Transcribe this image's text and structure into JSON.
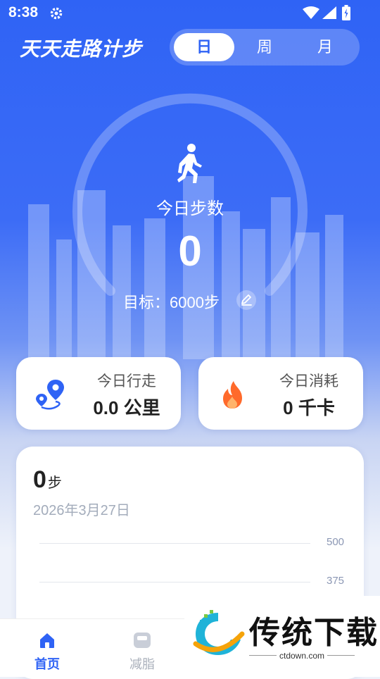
{
  "status_bar": {
    "time": "8:38"
  },
  "header": {
    "app_title": "天天走路计步",
    "period_tabs": [
      {
        "label": "日",
        "active": true
      },
      {
        "label": "周",
        "active": false
      },
      {
        "label": "月",
        "active": false
      }
    ]
  },
  "summary": {
    "today_label": "今日步数",
    "steps": "0",
    "goal_text": "目标：6000步",
    "progress": 0
  },
  "stats": {
    "distance": {
      "label": "今日行走",
      "value": "0.0 公里",
      "icon": "route-pin-icon"
    },
    "calories": {
      "label": "今日消耗",
      "value": "0 千卡",
      "icon": "flame-icon"
    }
  },
  "chart_card": {
    "steps_value": "0",
    "steps_unit": "步",
    "date": "2026年3月27日"
  },
  "chart_data": {
    "type": "bar",
    "y_ticks": [
      "500",
      "375"
    ],
    "ylim": [
      0,
      500
    ],
    "values": []
  },
  "tabbar": [
    {
      "label": "首页",
      "icon": "home-icon",
      "active": true
    },
    {
      "label": "减脂",
      "icon": "scale-icon",
      "active": false
    }
  ],
  "watermark": {
    "title": "传统下载",
    "url": "ctdown.com"
  },
  "colors": {
    "primary": "#2f63f5",
    "flame": "#ff6a2b",
    "muted": "#a3acbb"
  }
}
